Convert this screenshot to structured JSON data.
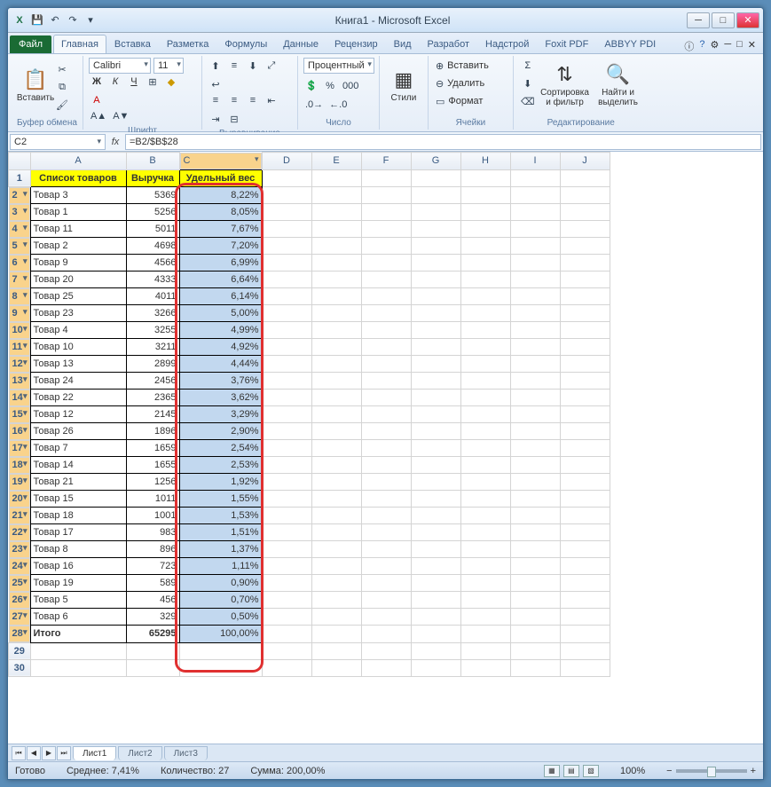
{
  "title": "Книга1 - Microsoft Excel",
  "tabs": {
    "file": "Файл",
    "list": [
      "Главная",
      "Вставка",
      "Разметка",
      "Формулы",
      "Данные",
      "Рецензир",
      "Вид",
      "Разработ",
      "Надстрой",
      "Foxit PDF",
      "ABBYY PDI"
    ],
    "active": 0
  },
  "ribbon": {
    "clipboard": {
      "paste": "Вставить",
      "label": "Буфер обмена"
    },
    "font": {
      "name": "Calibri",
      "size": "11",
      "label": "Шрифт"
    },
    "align": {
      "label": "Выравнивание"
    },
    "number": {
      "format": "Процентный",
      "label": "Число"
    },
    "styles": {
      "btn": "Стили",
      "label": ""
    },
    "cells": {
      "insert": "Вставить",
      "delete": "Удалить",
      "format": "Формат",
      "label": "Ячейки"
    },
    "editing": {
      "sort": "Сортировка и фильтр",
      "find": "Найти и выделить",
      "label": "Редактирование"
    }
  },
  "namebox": "C2",
  "formula": "=B2/$B$28",
  "cols": [
    "A",
    "B",
    "C",
    "D",
    "E",
    "F",
    "G",
    "H",
    "I",
    "J"
  ],
  "headers": [
    "Список товаров",
    "Выручка",
    "Удельный вес"
  ],
  "rows": [
    [
      "Товар 3",
      "5369",
      "8,22%"
    ],
    [
      "Товар 1",
      "5256",
      "8,05%"
    ],
    [
      "Товар 11",
      "5011",
      "7,67%"
    ],
    [
      "Товар 2",
      "4698",
      "7,20%"
    ],
    [
      "Товар 9",
      "4566",
      "6,99%"
    ],
    [
      "Товар 20",
      "4333",
      "6,64%"
    ],
    [
      "Товар 25",
      "4011",
      "6,14%"
    ],
    [
      "Товар 23",
      "3266",
      "5,00%"
    ],
    [
      "Товар 4",
      "3255",
      "4,99%"
    ],
    [
      "Товар 10",
      "3211",
      "4,92%"
    ],
    [
      "Товар 13",
      "2899",
      "4,44%"
    ],
    [
      "Товар 24",
      "2456",
      "3,76%"
    ],
    [
      "Товар 22",
      "2365",
      "3,62%"
    ],
    [
      "Товар 12",
      "2145",
      "3,29%"
    ],
    [
      "Товар 26",
      "1896",
      "2,90%"
    ],
    [
      "Товар 7",
      "1659",
      "2,54%"
    ],
    [
      "Товар 14",
      "1655",
      "2,53%"
    ],
    [
      "Товар 21",
      "1256",
      "1,92%"
    ],
    [
      "Товар 15",
      "1011",
      "1,55%"
    ],
    [
      "Товар 18",
      "1001",
      "1,53%"
    ],
    [
      "Товар 17",
      "983",
      "1,51%"
    ],
    [
      "Товар 8",
      "896",
      "1,37%"
    ],
    [
      "Товар 16",
      "723",
      "1,11%"
    ],
    [
      "Товар 19",
      "589",
      "0,90%"
    ],
    [
      "Товар 5",
      "456",
      "0,70%"
    ],
    [
      "Товар 6",
      "329",
      "0,50%"
    ]
  ],
  "total": {
    "label": "Итого",
    "value": "65295",
    "pct": "100,00%"
  },
  "sheets": [
    "Лист1",
    "Лист2",
    "Лист3"
  ],
  "status": {
    "ready": "Готово",
    "avg": "Среднее: 7,41%",
    "count": "Количество: 27",
    "sum": "Сумма: 200,00%",
    "zoom": "100%"
  }
}
